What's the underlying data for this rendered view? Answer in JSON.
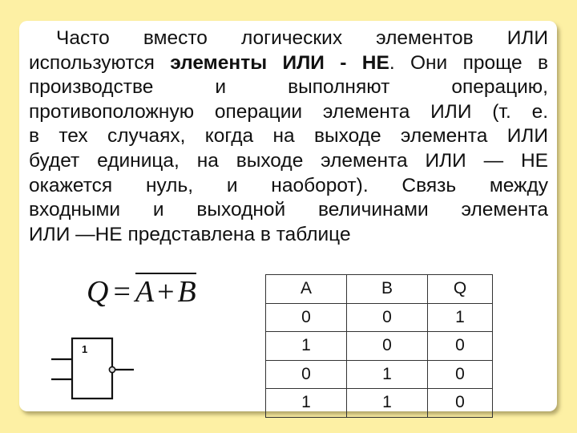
{
  "slide": {
    "background_color": "#fdf0a4",
    "card_color": "#ffffff",
    "paragraph": {
      "lines": [
        {
          "segments": [
            {
              "text": "Часто вместо логических элементов ИЛИ",
              "bold": false
            }
          ]
        },
        {
          "segments": [
            {
              "text": "используются ",
              "bold": false
            },
            {
              "text": "элементы ИЛИ - НЕ",
              "bold": true
            },
            {
              "text": ". Они проще в",
              "bold": false
            }
          ]
        },
        {
          "segments": [
            {
              "text": "производстве и выполняют операцию,",
              "bold": false
            }
          ]
        },
        {
          "segments": [
            {
              "text": "противоположную операции элемента ИЛИ (т. е.",
              "bold": false
            }
          ]
        },
        {
          "segments": [
            {
              "text": "в тех случаях, когда на выходе элемента ИЛИ",
              "bold": false
            }
          ]
        },
        {
          "segments": [
            {
              "text": "будет единица, на выходе элемента ИЛИ — НЕ",
              "bold": false
            }
          ]
        },
        {
          "segments": [
            {
              "text": "окажется нуль, и наоборот). Связь между",
              "bold": false
            }
          ]
        },
        {
          "segments": [
            {
              "text": "входными и выходной величинами элемента",
              "bold": false
            }
          ]
        },
        {
          "segments": [
            {
              "text": "ИЛИ —НЕ представлена в таблице",
              "bold": false
            }
          ]
        }
      ]
    },
    "formula": {
      "lhs": "Q",
      "equals": "=",
      "rhs_a": "A",
      "rhs_op": "+",
      "rhs_b": "B",
      "negated": true
    },
    "gate_diagram": {
      "label": "1",
      "inputs": 2,
      "inverted_output": true
    },
    "truth_table": {
      "headers": [
        "A",
        "B",
        "Q"
      ],
      "rows": [
        [
          "0",
          "0",
          "1"
        ],
        [
          "1",
          "0",
          "0"
        ],
        [
          "0",
          "1",
          "0"
        ],
        [
          "1",
          "1",
          "0"
        ]
      ]
    }
  }
}
